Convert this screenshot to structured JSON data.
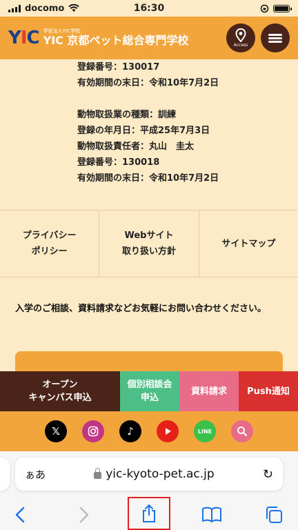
{
  "status_bar": {
    "carrier": "docomo",
    "time": "16:30"
  },
  "header": {
    "logo_mark": "YIC",
    "logo_small": "学校法人YIC学院",
    "logo_name": "YIC 京都ペット総合専門学校",
    "access_label": "Access"
  },
  "content": {
    "lines_group1": [
      "登録番号：130017",
      "有効期間の末日：令和10年7月2日"
    ],
    "lines_group2": [
      "動物取扱業の種類：訓練",
      "登録の年月日：平成25年7月3日",
      "動物取扱責任者：丸山　圭太",
      "登録番号：130018",
      "有効期間の末日：令和10年7月2日"
    ]
  },
  "links": [
    {
      "line1": "プライバシー",
      "line2": "ポリシー"
    },
    {
      "line1": "Webサイト",
      "line2": "取り扱い方針"
    },
    {
      "line1": "サイトマップ",
      "line2": ""
    }
  ],
  "inquiry_text": "入学のご相談、資料請求などお気軽にお問い合わせください。",
  "actions": [
    {
      "line1": "オープン",
      "line2": "キャンパス申込",
      "color": "#4a2419"
    },
    {
      "line1": "個別相談会",
      "line2": "申込",
      "color": "#4bbf85"
    },
    {
      "line1": "資料請求",
      "line2": "",
      "color": "#e86b87"
    },
    {
      "line1": "Push通知",
      "line2": "",
      "color": "#d8312f"
    }
  ],
  "social": [
    "x-icon",
    "instagram-icon",
    "tiktok-icon",
    "youtube-icon",
    "line-icon",
    "search-icon"
  ],
  "social_line_label": "LINE",
  "browser": {
    "aa_label": "ぁあ",
    "url": "yic-kyoto-pet.ac.jp"
  }
}
